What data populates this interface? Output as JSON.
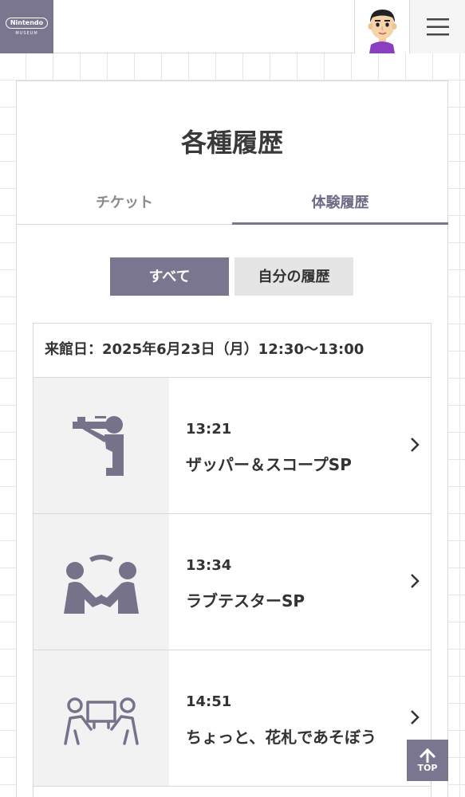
{
  "header": {
    "logo_text": "Nintendo",
    "logo_sub": "MUSEUM",
    "avatar_icon": "mii-avatar-icon",
    "menu_icon": "hamburger-menu-icon"
  },
  "page": {
    "title": "各種履歴",
    "tabs": [
      {
        "label": "チケット",
        "active": false
      },
      {
        "label": "体験履歴",
        "active": true
      }
    ],
    "filters": [
      {
        "label": "すべて",
        "active": true
      },
      {
        "label": "自分の履歴",
        "active": false
      }
    ],
    "visit_date": "来館日：2025年6月23日（月）12:30〜13:00",
    "entries": [
      {
        "time": "13:21",
        "title": "ザッパー＆スコープSP",
        "icon": "zapper-scope-icon"
      },
      {
        "time": "13:34",
        "title": "ラブテスターSP",
        "icon": "love-tester-icon"
      },
      {
        "time": "14:51",
        "title": "ちょっと、花札であそぼう",
        "icon": "hanafuda-icon"
      }
    ]
  },
  "top_button": {
    "label": "TOP",
    "icon": "arrow-up-icon"
  },
  "colors": {
    "accent": "#7a7690",
    "icon_bg": "#f2f2f2",
    "inactive_button": "#e5e5e5"
  }
}
